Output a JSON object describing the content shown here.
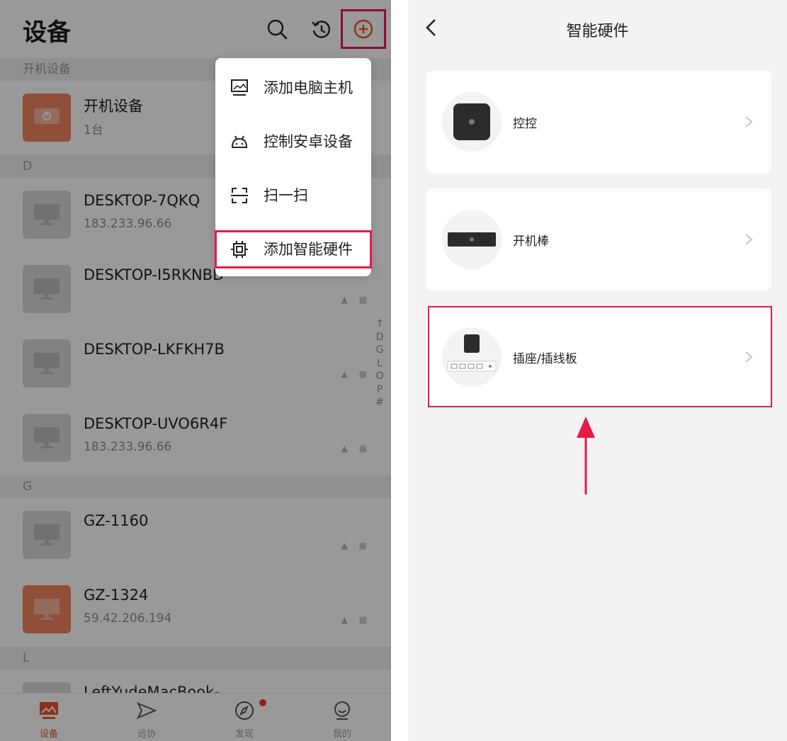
{
  "left": {
    "header": {
      "title": "设备"
    },
    "menu": {
      "items": [
        {
          "label": "添加电脑主机",
          "icon": "desktop-icon"
        },
        {
          "label": "控制安卓设备",
          "icon": "android-icon"
        },
        {
          "label": "扫一扫",
          "icon": "scan-icon"
        },
        {
          "label": "添加智能硬件",
          "icon": "chip-icon"
        }
      ]
    },
    "sections": [
      {
        "letter": "开机设备",
        "rows": [
          {
            "name": "开机设备",
            "sub": "1台",
            "thumb": "power-orange"
          }
        ]
      },
      {
        "letter": "D",
        "rows": [
          {
            "name": "DESKTOP-7QKQ",
            "sub": "183.233.96.66"
          },
          {
            "name": "DESKTOP-I5RKNBD",
            "sub": ""
          },
          {
            "name": "DESKTOP-LKFKH7B",
            "sub": ""
          },
          {
            "name": "DESKTOP-UVO6R4F",
            "sub": "183.233.96.66"
          }
        ]
      },
      {
        "letter": "G",
        "rows": [
          {
            "name": "GZ-1160",
            "sub": ""
          },
          {
            "name": "GZ-1324",
            "sub": "59.42.206.194",
            "thumb": "orange"
          }
        ]
      },
      {
        "letter": "L",
        "rows": [
          {
            "name": "LeftYudeMacBook-",
            "sub": ""
          }
        ]
      }
    ],
    "alpha_index": [
      "↑",
      "D",
      "G",
      "L",
      "O",
      "P",
      "#"
    ],
    "tabs": [
      {
        "label": "设备",
        "icon": "device-tab-icon",
        "active": true
      },
      {
        "label": "远协",
        "icon": "send-tab-icon"
      },
      {
        "label": "发现",
        "icon": "compass-tab-icon"
      },
      {
        "label": "我的",
        "icon": "profile-tab-icon"
      }
    ]
  },
  "right": {
    "header": {
      "title": "智能硬件"
    },
    "cards": [
      {
        "label": "控控",
        "image": "kongkong-device"
      },
      {
        "label": "开机棒",
        "image": "boot-stick-device"
      },
      {
        "label": "插座/插线板",
        "image": "socket-strip-device"
      }
    ]
  },
  "colors": {
    "accent": "#e8562a",
    "highlight": "#e6194b",
    "badge_dot": "#ff2f2f"
  }
}
